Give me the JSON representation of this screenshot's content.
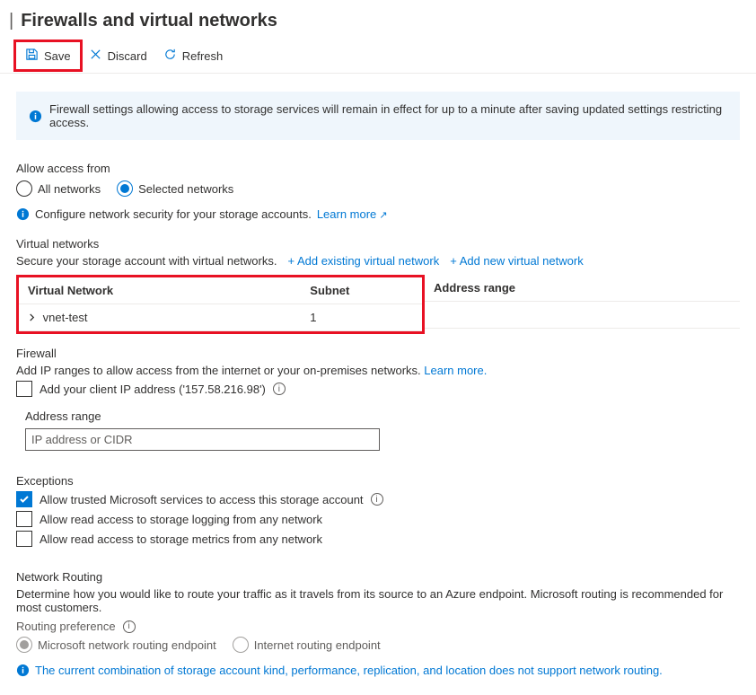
{
  "header": {
    "separator": "|",
    "title": "Firewalls and virtual networks"
  },
  "toolbar": {
    "save_label": "Save",
    "discard_label": "Discard",
    "refresh_label": "Refresh"
  },
  "banner": {
    "text": "Firewall settings allowing access to storage services will remain in effect for up to a minute after saving updated settings restricting access."
  },
  "access": {
    "label": "Allow access from",
    "all_label": "All networks",
    "selected_label": "Selected networks",
    "config_prefix": "Configure network security for your storage accounts.",
    "learn_more": "Learn more"
  },
  "vnet": {
    "heading": "Virtual networks",
    "desc": "Secure your storage account with virtual networks.",
    "add_existing": "+ Add existing virtual network",
    "add_new": "+ Add new virtual network",
    "col_network": "Virtual Network",
    "col_subnet": "Subnet",
    "col_address": "Address range",
    "rows": [
      {
        "name": "vnet-test",
        "subnet": "1"
      }
    ]
  },
  "firewall": {
    "heading": "Firewall",
    "desc_prefix": "Add IP ranges to allow access from the internet or your on-premises networks.",
    "learn_more": "Learn more.",
    "add_client_ip": "Add your client IP address ('157.58.216.98')",
    "address_label": "Address range",
    "address_placeholder": "IP address or CIDR"
  },
  "exceptions": {
    "heading": "Exceptions",
    "items": [
      {
        "checked": true,
        "label": "Allow trusted Microsoft services to access this storage account",
        "info": true
      },
      {
        "checked": false,
        "label": "Allow read access to storage logging from any network",
        "info": false
      },
      {
        "checked": false,
        "label": "Allow read access to storage metrics from any network",
        "info": false
      }
    ]
  },
  "routing": {
    "heading": "Network Routing",
    "desc": "Determine how you would like to route your traffic as it travels from its source to an Azure endpoint. Microsoft routing is recommended for most customers.",
    "pref_label": "Routing preference",
    "ms_label": "Microsoft network routing endpoint",
    "internet_label": "Internet routing endpoint",
    "unsupported": "The current combination of storage account kind, performance, replication, and location does not support network routing."
  }
}
